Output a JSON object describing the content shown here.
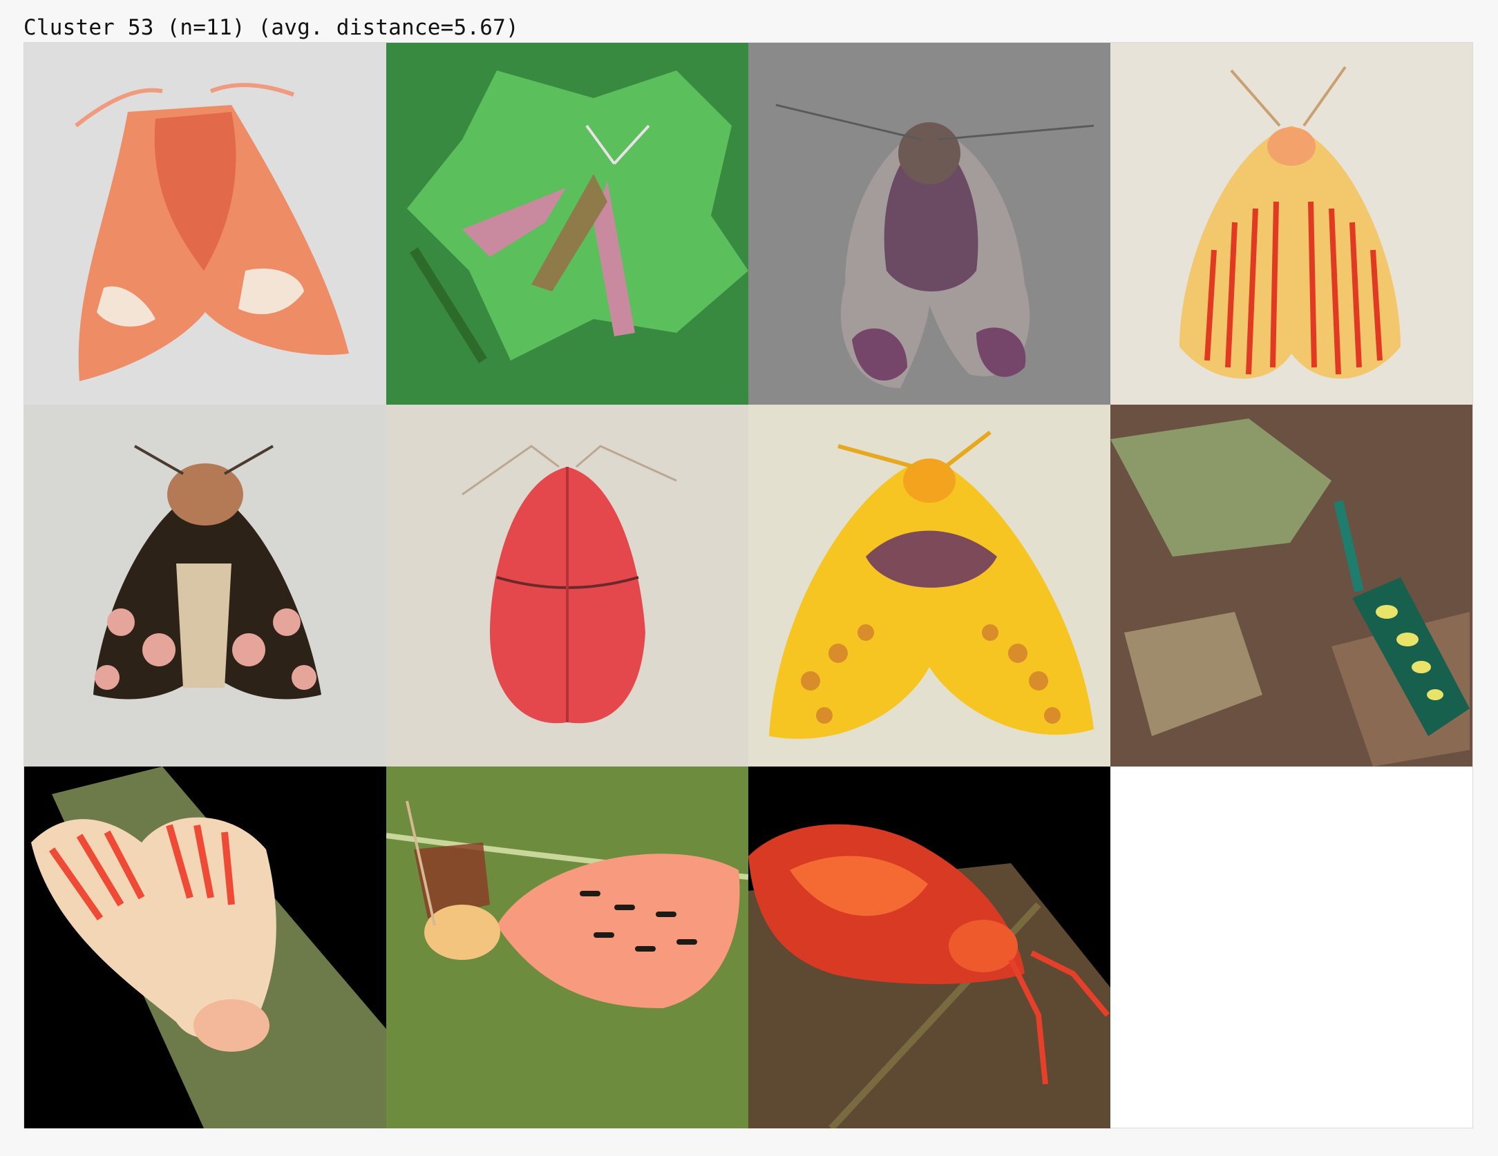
{
  "header": {
    "title": "Cluster 53 (n=11) (avg. distance=5.67)"
  },
  "grid": {
    "columns": 4,
    "rows": 3,
    "cell_count": 11,
    "tiles": [
      {
        "subject": "pink-orange moth on white",
        "background": "#dcdcdc",
        "accent": "#f08a63"
      },
      {
        "subject": "elephant hawk-moth on nettle leaves",
        "background": "#3e8f3c",
        "accent": "#d98fb0"
      },
      {
        "subject": "purple brown moth on grey surface",
        "background": "#858585",
        "accent": "#7a4a6a"
      },
      {
        "subject": "yellow moth with red stripes",
        "background": "#e4e0d6",
        "accent": "#e03a22"
      },
      {
        "subject": "dark brown moth with pink spots",
        "background": "#d8d8d4",
        "accent": "#2b2018"
      },
      {
        "subject": "red pink moth on textured cloth",
        "background": "#ddd9ce",
        "accent": "#e0464a"
      },
      {
        "subject": "yellow moth with dark blotches",
        "background": "#e2dfcf",
        "accent": "#f6c21c"
      },
      {
        "subject": "green lanternfly on tree bark",
        "background": "#6a5040",
        "accent": "#1f6f5a"
      },
      {
        "subject": "red striped tiger moth on leaf",
        "background": "#000000",
        "accent": "#f2583b"
      },
      {
        "subject": "salmon pink moth on green leaf",
        "background": "#607a3a",
        "accent": "#f59278"
      },
      {
        "subject": "red moth on leaf at night",
        "background": "#000000",
        "accent": "#e53a22"
      }
    ]
  }
}
